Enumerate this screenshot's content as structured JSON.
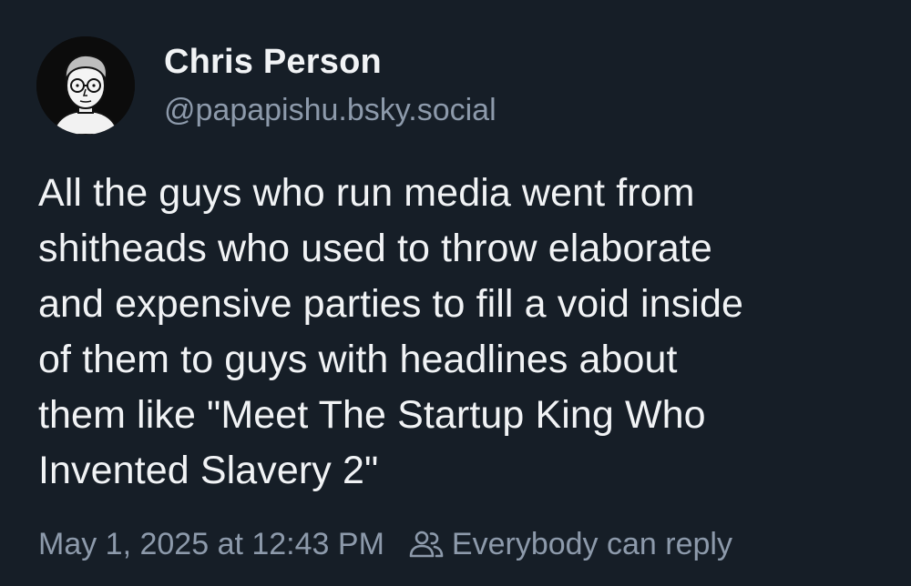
{
  "author": {
    "display_name": "Chris Person",
    "handle": "@papapishu.bsky.social"
  },
  "post": {
    "text": "All the guys who run media went from\nshitheads who used to throw elaborate\nand expensive parties to fill a void inside\nof them to guys with headlines about\nthem like \"Meet The Startup King Who\nInvented Slavery 2\""
  },
  "footer": {
    "timestamp": "May 1, 2025 at 12:43 PM",
    "reply_setting": "Everybody can reply",
    "reply_icon": "people-icon"
  },
  "colors": {
    "background": "#161e27",
    "text": "#f1f3f5",
    "muted": "#8d9aab"
  }
}
